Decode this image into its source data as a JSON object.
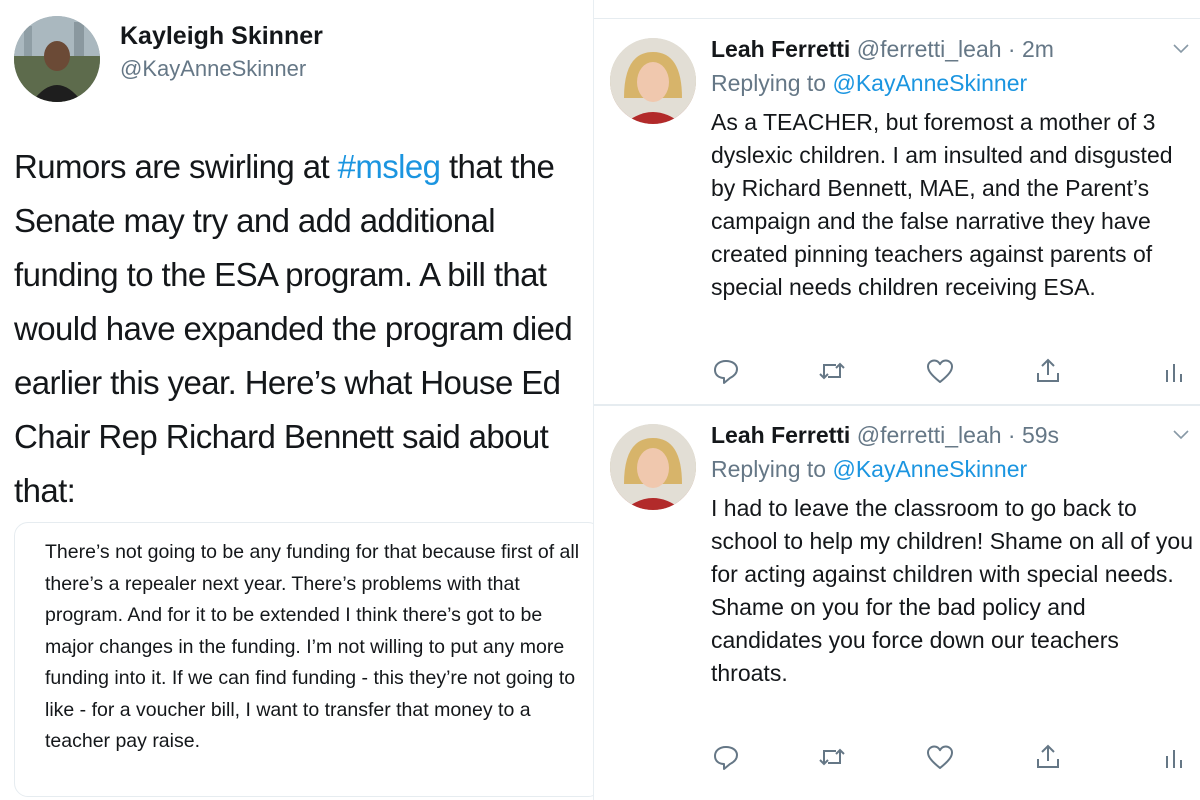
{
  "main_tweet": {
    "author_name": "Kayleigh Skinner",
    "author_handle": "@KayAnneSkinner",
    "text_before_hashtag": "Rumors are swirling at ",
    "hashtag": "#msleg",
    "text_after_hashtag": " that the Senate may try and add additional funding to the ESA program. A bill that would have expanded the program died earlier this year. Here’s what House Ed Chair Rep Richard Bennett said about that:",
    "quote": "There’s not going to be any funding for that because first of all there’s a repealer next year. There’s problems with that program. And for it to be extended I think there’s got to be major changes in the funding. I’m not willing to put any more funding into it. If we can find funding - this they’re not going to like - for a voucher bill, I want to transfer that money to a teacher pay raise."
  },
  "replies": [
    {
      "author_name": "Leah Ferretti",
      "handle_time": "@ferretti_leah · 2m",
      "replying_prefix": "Replying to ",
      "replying_to": "@KayAnneSkinner",
      "text": "As a TEACHER, but foremost a mother of 3 dyslexic children. I am insulted and disgusted by Richard Bennett, MAE, and the Parent’s campaign and the false narrative they have created pinning teachers against parents of special needs children receiving ESA."
    },
    {
      "author_name": "Leah Ferretti",
      "handle_time": "@ferretti_leah · 59s",
      "replying_prefix": "Replying to ",
      "replying_to": "@KayAnneSkinner",
      "text": "I had to leave the classroom to go back to school to help my children!  Shame on all of you for acting against children with special needs. Shame on you for the bad policy and candidates you force down our teachers throats."
    }
  ],
  "icons": [
    "reply-icon",
    "retweet-icon",
    "like-icon",
    "share-icon",
    "analytics-icon",
    "chevron-down-icon"
  ],
  "colors": {
    "link": "#1b95e0",
    "secondary_text": "#657786",
    "icon": "#657786"
  }
}
